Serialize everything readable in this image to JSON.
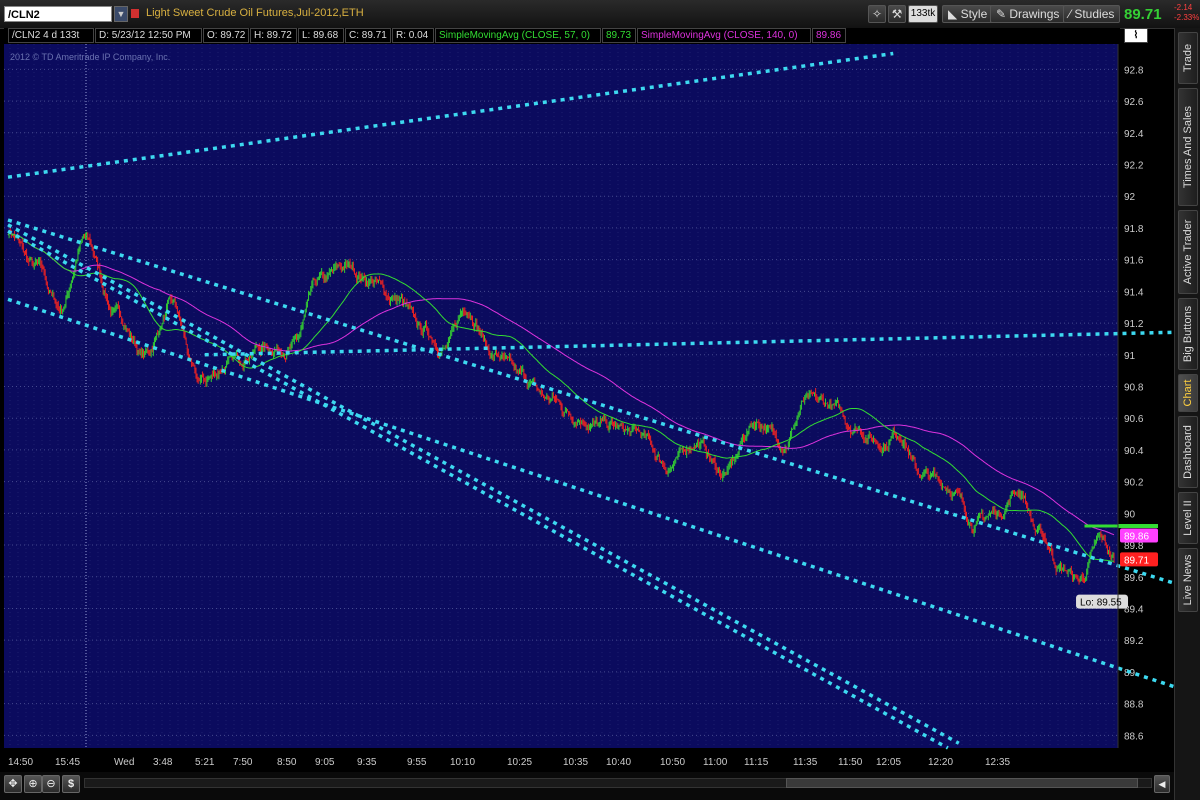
{
  "toolbar": {
    "symbol": "/CLN2",
    "description": "Light Sweet Crude Oil Futures,Jul-2012,ETH",
    "ticks_button": "133tk",
    "style_label": "Style",
    "drawings_label": "Drawings",
    "studies_label": "Studies",
    "last_price": "89.71",
    "change": "-2.14",
    "change_pct": "-2.33%"
  },
  "info_bar": {
    "symbol_period": "/CLN2 4 d 133t",
    "date": "D: 5/23/12 12:50 PM",
    "open": "O: 89.72",
    "high": "H: 89.72",
    "low": "L: 89.68",
    "close": "C: 89.71",
    "range": "R: 0.04",
    "sma57_label": "SimpleMovingAvg (CLOSE, 57, 0)",
    "sma57_value": "89.73",
    "sma140_label": "SimpleMovingAvg (CLOSE, 140, 0)",
    "sma140_value": "89.86"
  },
  "copyright": "2012 © TD Ameritrade IP Company, Inc.",
  "right_tabs": [
    "Trade",
    "Times And Sales",
    "Active Trader",
    "Big Buttons",
    "Chart",
    "Dashboard",
    "Level II",
    "Live News"
  ],
  "active_tab": "Chart",
  "colors": {
    "background": "#0b0b5e",
    "grid": "#454a8f",
    "trendline": "#3dd9f0",
    "sma57": "#33dd33",
    "sma140": "#dd33dd",
    "up": "#33cc33",
    "down": "#ee2222"
  },
  "chart_data": {
    "type": "candlestick",
    "title": "",
    "y_ticks": [
      88.6,
      88.8,
      89,
      89.2,
      89.4,
      89.6,
      89.8,
      90,
      90.2,
      90.4,
      90.6,
      90.8,
      91,
      91.2,
      91.4,
      91.6,
      91.8,
      92,
      92.2,
      92.4,
      92.6,
      92.8
    ],
    "ylim": [
      88.52,
      92.96
    ],
    "x_ticks": [
      "14:50",
      "15:45",
      "Wed",
      "3:48",
      "5:21",
      "7:50",
      "8:50",
      "9:05",
      "9:35",
      "9:55",
      "10:10",
      "10:25",
      "10:35",
      "10:40",
      "10:50",
      "11:00",
      "11:15",
      "11:35",
      "11:50",
      "12:05",
      "12:20",
      "12:35"
    ],
    "n_bars": 1012,
    "price_path": [
      [
        0,
        91.78
      ],
      [
        25,
        91.55
      ],
      [
        48,
        91.3
      ],
      [
        70,
        91.72
      ],
      [
        100,
        91.25
      ],
      [
        125,
        91.0
      ],
      [
        150,
        91.3
      ],
      [
        175,
        90.82
      ],
      [
        205,
        90.95
      ],
      [
        230,
        91.05
      ],
      [
        260,
        91.05
      ],
      [
        285,
        91.45
      ],
      [
        310,
        91.55
      ],
      [
        330,
        91.48
      ],
      [
        355,
        91.35
      ],
      [
        380,
        91.15
      ],
      [
        400,
        91.05
      ],
      [
        420,
        91.3
      ],
      [
        445,
        91.0
      ],
      [
        470,
        90.85
      ],
      [
        495,
        90.72
      ],
      [
        520,
        90.62
      ],
      [
        545,
        90.55
      ],
      [
        575,
        90.5
      ],
      [
        605,
        90.3
      ],
      [
        630,
        90.45
      ],
      [
        655,
        90.25
      ],
      [
        685,
        90.58
      ],
      [
        710,
        90.45
      ],
      [
        730,
        90.7
      ],
      [
        750,
        90.68
      ],
      [
        775,
        90.55
      ],
      [
        800,
        90.45
      ],
      [
        815,
        90.52
      ],
      [
        835,
        90.25
      ],
      [
        860,
        90.18
      ],
      [
        885,
        89.95
      ],
      [
        905,
        90.0
      ],
      [
        925,
        90.15
      ],
      [
        945,
        89.85
      ],
      [
        965,
        89.65
      ],
      [
        980,
        89.58
      ],
      [
        1000,
        89.82
      ],
      [
        1012,
        89.71
      ]
    ],
    "day_low": 89.55,
    "day_low_label": "Lo: 89.55",
    "series": [
      {
        "name": "SimpleMovingAvg (CLOSE, 57, 0)",
        "last": 89.73
      },
      {
        "name": "SimpleMovingAvg (CLOSE, 140, 0)",
        "last": 89.86
      }
    ],
    "horizontal_line": 89.92,
    "price_labels": [
      {
        "value": "89.86",
        "y": 89.86
      },
      {
        "value": "89.71",
        "y": 89.71
      }
    ],
    "trendlines": [
      [
        [
          0,
          92.12
        ],
        [
          810,
          92.9
        ]
      ],
      [
        [
          0,
          91.85
        ],
        [
          1118,
          89.45
        ]
      ],
      [
        [
          0,
          91.35
        ],
        [
          1118,
          88.79
        ]
      ],
      [
        [
          180,
          91.0
        ],
        [
          1118,
          91.15
        ]
      ],
      [
        [
          0,
          91.82
        ],
        [
          870,
          88.55
        ]
      ],
      [
        [
          0,
          91.78
        ],
        [
          860,
          88.52
        ]
      ]
    ],
    "grid": true
  }
}
